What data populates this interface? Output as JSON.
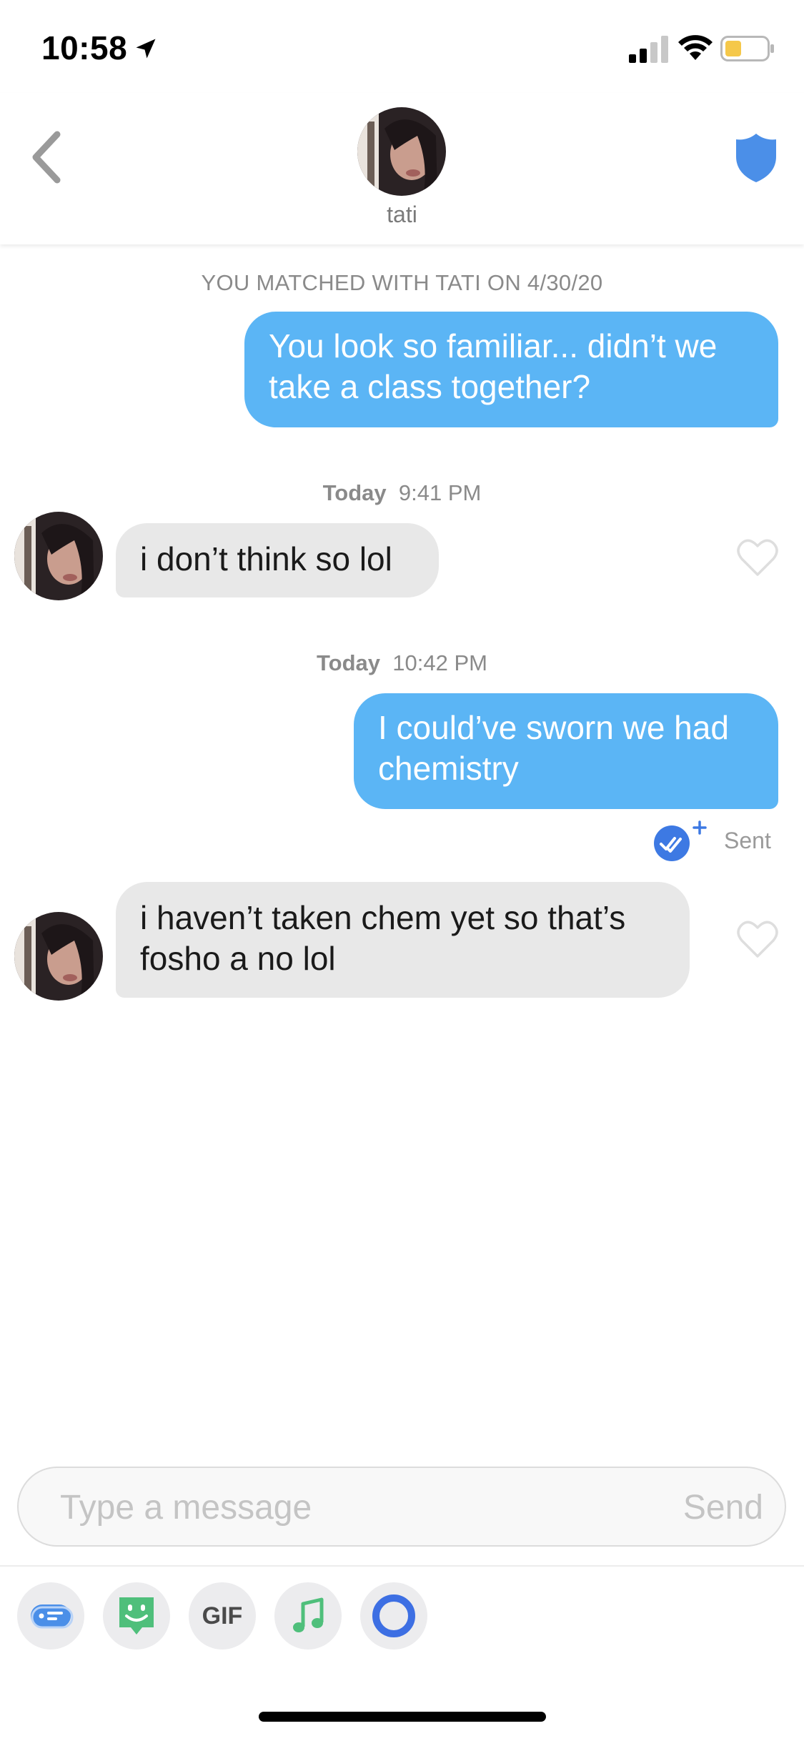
{
  "status_bar": {
    "time": "10:58",
    "icons": [
      "location-arrow-icon",
      "cellular-signal-icon",
      "wifi-icon",
      "battery-icon"
    ],
    "battery_color": "#f5c84a"
  },
  "header": {
    "contact_name": "tati",
    "icons": [
      "back-chevron-icon",
      "safety-shield-icon"
    ],
    "shield_color": "#4b8fe8"
  },
  "chat": {
    "match_note": "YOU MATCHED WITH TATI ON 4/30/20",
    "messages": [
      {
        "direction": "outgoing",
        "text_lines": [
          "You look so familiar... didn’t we",
          "take a class together?"
        ]
      },
      {
        "type": "timestamp",
        "day": "Today",
        "time": "9:41 PM"
      },
      {
        "direction": "incoming",
        "text_lines": [
          "i don’t think so lol"
        ]
      },
      {
        "type": "timestamp",
        "day": "Today",
        "time": "10:42 PM"
      },
      {
        "direction": "outgoing",
        "text_lines": [
          "I could’ve sworn we had",
          "chemistry"
        ]
      },
      {
        "direction": "incoming",
        "text_lines": [
          "i haven’t taken chem yet so that’s",
          "fosho a no lol"
        ]
      }
    ],
    "status": "Sent",
    "outgoing_color": "#5bb5f5",
    "incoming_color": "#e8e8e8"
  },
  "composer": {
    "placeholder": "Type a message",
    "send_label": "Send"
  },
  "toolbar": {
    "buttons": [
      "quick-replies-icon",
      "sticker-icon",
      "GIF",
      "music-note-icon",
      "loop-icon"
    ],
    "gif_label": "GIF"
  }
}
